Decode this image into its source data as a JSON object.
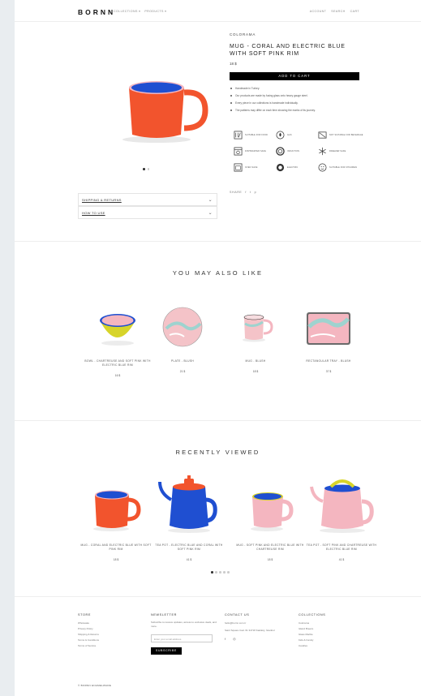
{
  "header": {
    "logo": "BORNN",
    "nav": [
      "COLLECTIONS ▾",
      "PRODUCTS ▾"
    ],
    "utility": [
      "ACCOUNT",
      "SEARCH",
      "CART"
    ]
  },
  "product": {
    "brand": "COLORAMA",
    "title": "MUG - CORAL AND ELECTRIC BLUE WITH SOFT PINK RIM",
    "price": "18 $",
    "add_to_cart": "ADD TO CART",
    "bullets": [
      "Handmade in Turkey.",
      "Our products are made by fusing glass onto heavy gauge steel.",
      "Every piece in our collections is handmade individually.",
      "The patterns may differ on each item showing the marks of its journey."
    ],
    "care": [
      {
        "icon": "food-safe-icon",
        "label": "SUITABLE FOR FOOD"
      },
      {
        "icon": "gas-icon",
        "label": "GAS"
      },
      {
        "icon": "not-beverage-icon",
        "label": "NOT SUITABLE FOR BEVERAGE"
      },
      {
        "icon": "dishwasher-icon",
        "label": "DISHWASHER SAFE"
      },
      {
        "icon": "induction-icon",
        "label": "INDUCTION"
      },
      {
        "icon": "freezer-icon",
        "label": "FREEZER SAFE"
      },
      {
        "icon": "oven-icon",
        "label": "OVEN SAFE"
      },
      {
        "icon": "electric-icon",
        "label": "ELECTRIC"
      },
      {
        "icon": "children-icon",
        "label": "SUITABLE FOR CHILDREN"
      }
    ],
    "share_label": "SHARE",
    "share_icons": [
      "f",
      "t",
      "p"
    ],
    "accordions": [
      "SHIPPING & RETURNS",
      "HOW TO USE"
    ]
  },
  "also_like": {
    "title": "YOU MAY ALSO LIKE",
    "items": [
      {
        "name": "BOWL - CHARTREUSE AND SOFT PINK WITH ELECTRIC BLUE RIM",
        "price": "16 $"
      },
      {
        "name": "PLATE - BLUSH",
        "price": "21 $"
      },
      {
        "name": "MUG - BLUSH",
        "price": "18 $"
      },
      {
        "name": "RECTANGULAR TRAY - BLUSH",
        "price": "37 $"
      }
    ]
  },
  "recently_viewed": {
    "title": "RECENTLY VIEWED",
    "items": [
      {
        "name": "MUG - CORAL AND ELECTRIC BLUE WITH SOFT PINK RIM",
        "price": "18 $"
      },
      {
        "name": "TEA POT - ELECTRIC BLUE AND CORAL WITH SOFT PINK RIM",
        "price": "41 $"
      },
      {
        "name": "MUG - SOFT PINK AND ELECTRIC BLUE WITH CHARTREUSE RIM",
        "price": "18 $"
      },
      {
        "name": "TEA POT - SOFT PINK AND CHARTREUSE WITH ELECTRIC BLUE RIM",
        "price": "41 $"
      }
    ]
  },
  "footer": {
    "store": {
      "title": "STORE",
      "links": [
        "Wholesale",
        "Privacy Policy",
        "Shipping & Returns",
        "Terms & Conditions",
        "Terms of Service"
      ]
    },
    "newsletter": {
      "title": "NEWSLETTER",
      "text": "Subscribe to receive updates, access to exclusive deals, and more.",
      "placeholder": "Enter your email address",
      "button": "SUBSCRIBE"
    },
    "contact": {
      "title": "CONTACT US",
      "email": "hello@bornn.com.tr",
      "address": "Saint Square Cad. 61 34718 Kadıköy, İstanbul",
      "social": [
        "f",
        "◎"
      ]
    },
    "collections": {
      "title": "COLLECTIONS",
      "links": [
        "Colorama",
        "Island Breeze",
        "Glass Marble",
        "Kids & Family",
        "Candles"
      ]
    },
    "copyright": "© BORNN ENAMELWARE"
  },
  "colors": {
    "coral": "#f2542d",
    "electric_blue": "#1f4fd1",
    "soft_pink": "#f4b6c0",
    "chartreuse": "#d7d42a",
    "black": "#000000"
  }
}
